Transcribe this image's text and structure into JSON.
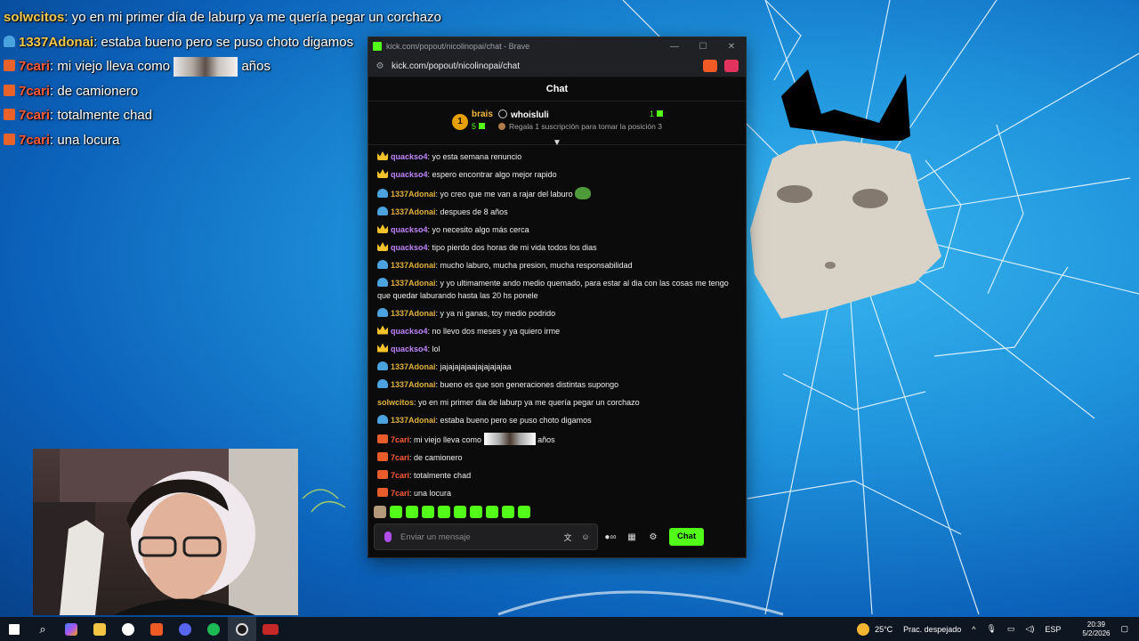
{
  "overlay_chat": [
    {
      "user": "solwcitos",
      "badge": "none",
      "color": "#f2c94c",
      "text": ": yo en mi primer día de laburp ya me quería pegar un corchazo"
    },
    {
      "user": "1337Adonai",
      "badge": "sub",
      "color": "#f2c94c",
      "text": ": estaba bueno pero se puso choto digamos"
    },
    {
      "user": "7cari",
      "badge": "orange",
      "color": "#ff5a3a",
      "text": ": mi viejo lleva como",
      "suffix": "años"
    },
    {
      "user": "7cari",
      "badge": "orange",
      "color": "#ff5a3a",
      "text": ": de camionero"
    },
    {
      "user": "7cari",
      "badge": "orange",
      "color": "#ff5a3a",
      "text": ": totalmente chad"
    },
    {
      "user": "7cari",
      "badge": "orange",
      "color": "#ff5a3a",
      "text": ": una locura"
    }
  ],
  "browser": {
    "title": "kick.com/popout/nicolinopai/chat - Brave",
    "url": "kick.com/popout/nicolinopai/chat",
    "controls": {
      "minimize": "—",
      "maximize": "☐",
      "close": "✕"
    }
  },
  "chat": {
    "header": "Chat",
    "leaderboard": {
      "rank": "1",
      "first_name": "brais",
      "first_count": "5",
      "second_name": "whoisluli",
      "second_count": "1",
      "hint": "Regala 1 suscripción para tomar la posición 3"
    },
    "messages": [
      {
        "user": "quackso4",
        "badge": "crown",
        "color": "#c084fc",
        "text": ": yo esta semana renuncio"
      },
      {
        "user": "quackso4",
        "badge": "crown",
        "color": "#c084fc",
        "text": ": espero encontrar algo mejor rapido"
      },
      {
        "user": "1337Adonai",
        "badge": "sub",
        "color": "#e0b03c",
        "text": ": yo creo que me van a rajar del laburo",
        "emote": true
      },
      {
        "user": "1337Adonai",
        "badge": "sub",
        "color": "#e0b03c",
        "text": ": despues de 8 años"
      },
      {
        "user": "quackso4",
        "badge": "crown",
        "color": "#c084fc",
        "text": ": yo necesito algo más cerca"
      },
      {
        "user": "quackso4",
        "badge": "crown",
        "color": "#c084fc",
        "text": ": tipo pierdo dos horas de mi vida todos los dias"
      },
      {
        "user": "1337Adonai",
        "badge": "sub",
        "color": "#e0b03c",
        "text": ": mucho laburo, mucha presion, mucha responsabilidad"
      },
      {
        "user": "1337Adonai",
        "badge": "sub",
        "color": "#e0b03c",
        "text": ": y yo ultimamente ando medio quemado, para estar al dia con las cosas me tengo que quedar laburando hasta las 20 hs ponele"
      },
      {
        "user": "1337Adonai",
        "badge": "sub",
        "color": "#e0b03c",
        "text": ": y ya ni ganas, toy medio podrido"
      },
      {
        "user": "quackso4",
        "badge": "crown",
        "color": "#c084fc",
        "text": ": no llevo dos meses y ya quiero irme"
      },
      {
        "user": "quackso4",
        "badge": "crown",
        "color": "#c084fc",
        "text": ": lol"
      },
      {
        "user": "1337Adonai",
        "badge": "sub",
        "color": "#e0b03c",
        "text": ": jajajajajaajajajajajaa"
      },
      {
        "user": "1337Adonai",
        "badge": "sub",
        "color": "#e0b03c",
        "text": ": bueno es que son generaciones distintas supongo"
      },
      {
        "user": "solwcitos",
        "badge": "none",
        "color": "#e0b03c",
        "text": ": yo en mi primer dia de laburp ya me quería pegar un corchazo"
      },
      {
        "user": "1337Adonai",
        "badge": "sub",
        "color": "#e0b03c",
        "text": ": estaba bueno pero se puso choto digamos"
      },
      {
        "user": "7cari",
        "badge": "og",
        "color": "#ff5a3a",
        "text": ": mi viejo lleva como",
        "suffix": "años"
      },
      {
        "user": "7cari",
        "badge": "og",
        "color": "#ff5a3a",
        "text": ": de camionero"
      },
      {
        "user": "7cari",
        "badge": "og",
        "color": "#ff5a3a",
        "text": ": totalmente chad"
      },
      {
        "user": "7cari",
        "badge": "og",
        "color": "#ff5a3a",
        "text": ": una locura"
      }
    ],
    "input_placeholder": "Enviar un mensaje",
    "send_label": "Chat",
    "accent": "#53fc18"
  },
  "taskbar": {
    "temperature": "25°C",
    "weather": "Prac. despejado",
    "language": "ESP",
    "time": "20:39",
    "date": "5/2/2026"
  }
}
